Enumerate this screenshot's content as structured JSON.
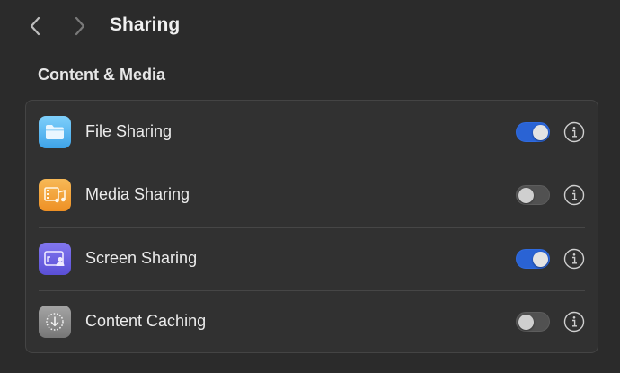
{
  "header": {
    "title": "Sharing",
    "back_icon": "chevron-left-icon",
    "forward_icon": "chevron-right-icon"
  },
  "section": {
    "title": "Content & Media"
  },
  "rows": [
    {
      "label": "File Sharing",
      "icon": "folder-icon",
      "enabled": true,
      "icon_color": "#5ab8f0"
    },
    {
      "label": "Media Sharing",
      "icon": "media-icon",
      "enabled": false,
      "icon_color": "#f2a33a"
    },
    {
      "label": "Screen Sharing",
      "icon": "screen-sharing-icon",
      "enabled": true,
      "icon_color": "#6a5fe0"
    },
    {
      "label": "Content Caching",
      "icon": "download-circle-icon",
      "enabled": false,
      "icon_color": "#8e8e8e"
    }
  ],
  "colors": {
    "background": "#2b2b2b",
    "panel": "#313131",
    "toggle_on": "#2a63d4",
    "toggle_off": "#515151"
  }
}
